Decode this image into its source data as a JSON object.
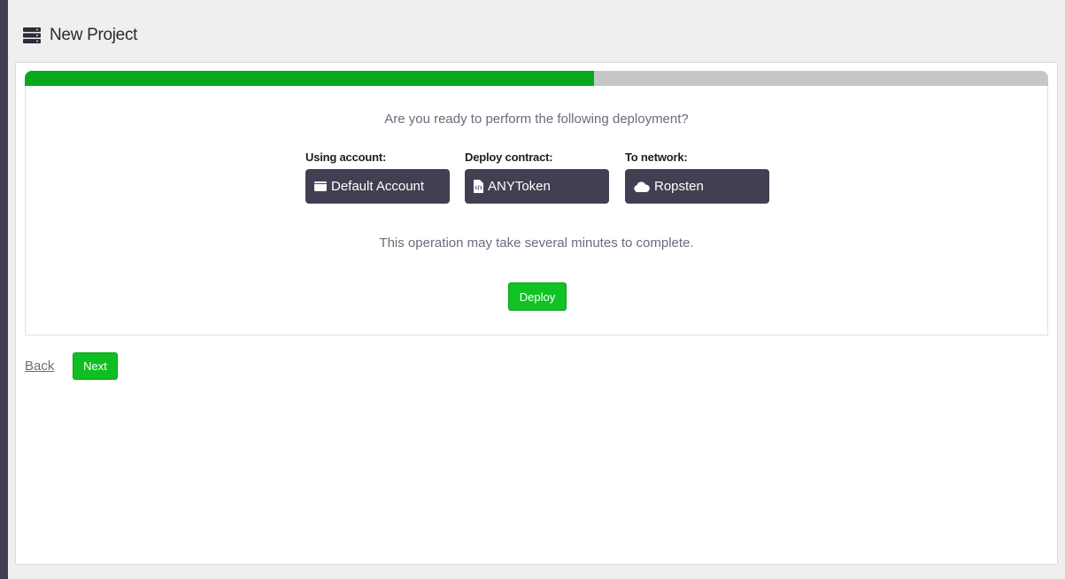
{
  "header": {
    "title": "New Project",
    "icon": "server-icon"
  },
  "progress": {
    "percent": 55.6,
    "fill_color": "#07a81b",
    "track_color": "#c6c5ca"
  },
  "confirm": {
    "question": "Are you ready to perform the following deployment?",
    "account": {
      "label": "Using account:",
      "value": "Default Account",
      "icon": "wallet-icon"
    },
    "contract": {
      "label": "Deploy contract:",
      "value": "ANYToken",
      "icon": "code-file-icon"
    },
    "network": {
      "label": "To network:",
      "value": "Ropsten",
      "icon": "cloud-icon"
    },
    "note": "This operation may take several minutes to complete.",
    "deploy_label": "Deploy"
  },
  "nav": {
    "back_label": "Back",
    "next_label": "Next"
  },
  "colors": {
    "accent": "#10c323",
    "dark_box": "#423f52",
    "rail": "#403e52"
  }
}
